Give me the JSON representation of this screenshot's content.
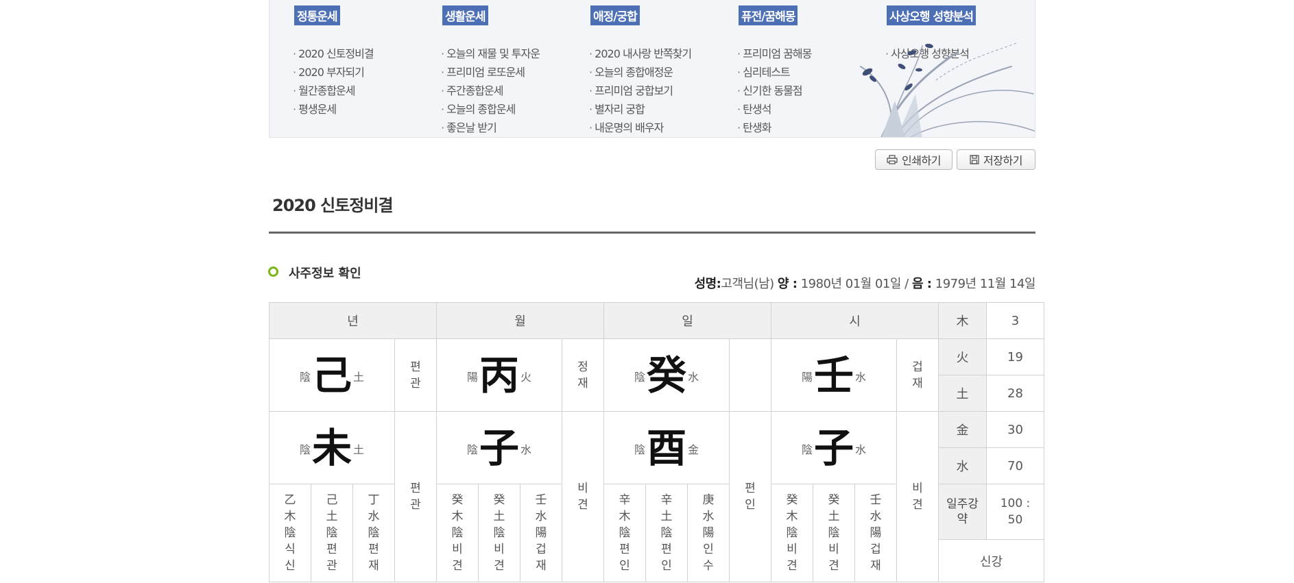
{
  "menu": {
    "columns": [
      {
        "head": "정통운세",
        "items": [
          "2020 신토정비결",
          "2020 부자되기",
          "월간종합운세",
          "평생운세"
        ]
      },
      {
        "head": "생활운세",
        "items": [
          "오늘의 재물 및 투자운",
          "프리미엄 로또운세",
          "주간종합운세",
          "오늘의 종합운세",
          "좋은날 받기"
        ]
      },
      {
        "head": "애정/궁합",
        "items": [
          "2020 내사랑 반쪽찾기",
          "오늘의 종합애정운",
          "프리미엄 궁합보기",
          "별자리 궁합",
          "내운명의 배우자"
        ]
      },
      {
        "head": "퓨전/꿈해몽",
        "items": [
          "프리미엄 꿈해몽",
          "심리테스트",
          "신기한 동물점",
          "탄생석",
          "탄생화"
        ]
      },
      {
        "head": "사상오행 성향분석",
        "items": [
          "사상오행 성향분석"
        ]
      }
    ]
  },
  "toolbar": {
    "print_label": "인쇄하기",
    "save_label": "저장하기"
  },
  "page": {
    "title": "2020 신토정비결"
  },
  "section": {
    "title": "사주정보 확인"
  },
  "person": {
    "name_label": "성명:",
    "name": "고객님(남)",
    "solar_label": "양 :",
    "solar_date": "1980년 01월 01일",
    "sep": "/",
    "lunar_label": "음 :",
    "lunar_date": "1979년 11월 14일"
  },
  "saju": {
    "headers": [
      "년",
      "월",
      "일",
      "시"
    ],
    "pillars": [
      {
        "stem": {
          "yy": "陰",
          "hanja": "己",
          "el": "土"
        },
        "stem_god": "편관",
        "branch": {
          "yy": "陰",
          "hanja": "未",
          "el": "土"
        },
        "branch_god": "편관",
        "hidden": [
          "乙木陰식신",
          "己土陰편관",
          "丁水陰편재"
        ]
      },
      {
        "stem": {
          "yy": "陽",
          "hanja": "丙",
          "el": "火"
        },
        "stem_god": "정재",
        "branch": {
          "yy": "陰",
          "hanja": "子",
          "el": "水"
        },
        "branch_god": "비견",
        "hidden": [
          "癸木陰비견",
          "癸土陰비견",
          "壬水陽겁재"
        ]
      },
      {
        "stem": {
          "yy": "陰",
          "hanja": "癸",
          "el": "水"
        },
        "stem_god": "",
        "branch": {
          "yy": "陰",
          "hanja": "酉",
          "el": "金"
        },
        "branch_god": "편인",
        "hidden": [
          "辛木陰편인",
          "辛土陰편인",
          "庚水陽인수"
        ]
      },
      {
        "stem": {
          "yy": "陽",
          "hanja": "壬",
          "el": "水"
        },
        "stem_god": "겁재",
        "branch": {
          "yy": "陰",
          "hanja": "子",
          "el": "水"
        },
        "branch_god": "비견",
        "hidden": [
          "癸木陰비견",
          "癸土陰비견",
          "壬水陽겁재"
        ]
      }
    ],
    "elements": [
      {
        "label": "木",
        "value": "3"
      },
      {
        "label": "火",
        "value": "19"
      },
      {
        "label": "土",
        "value": "28"
      },
      {
        "label": "金",
        "value": "30"
      },
      {
        "label": "水",
        "value": "70"
      }
    ],
    "strength_label": "일주강약",
    "strength_value": "100 : 50",
    "strength_result": "신강"
  }
}
